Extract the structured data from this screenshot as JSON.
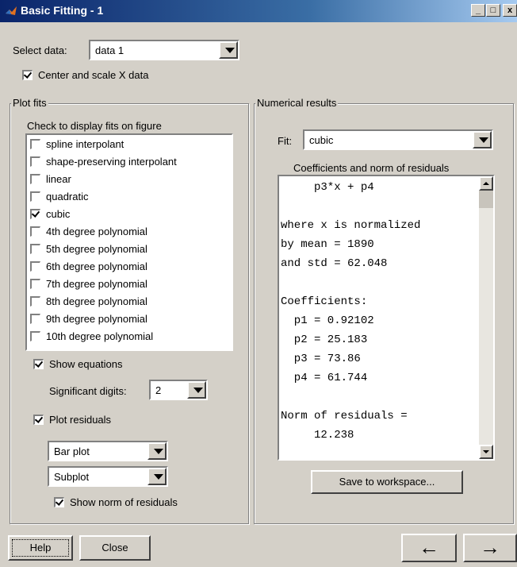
{
  "window": {
    "title": "Basic Fitting - 1",
    "minimize": "_",
    "maximize": "□",
    "close": "x"
  },
  "select_data": {
    "label": "Select data:",
    "value": "data 1"
  },
  "center_scale": {
    "label": "Center and scale X data",
    "checked": true
  },
  "plot_fits": {
    "title": "Plot fits",
    "instruction": "Check to display fits on figure",
    "items": [
      {
        "label": "spline interpolant",
        "checked": false
      },
      {
        "label": "shape-preserving interpolant",
        "checked": false
      },
      {
        "label": "linear",
        "checked": false
      },
      {
        "label": "quadratic",
        "checked": false
      },
      {
        "label": "cubic",
        "checked": true
      },
      {
        "label": "4th degree polynomial",
        "checked": false
      },
      {
        "label": "5th degree polynomial",
        "checked": false
      },
      {
        "label": "6th degree polynomial",
        "checked": false
      },
      {
        "label": "7th degree polynomial",
        "checked": false
      },
      {
        "label": "8th degree polynomial",
        "checked": false
      },
      {
        "label": "9th degree polynomial",
        "checked": false
      },
      {
        "label": "10th degree polynomial",
        "checked": false
      }
    ],
    "show_equations": {
      "label": "Show equations",
      "checked": true
    },
    "sig_digits": {
      "label": "Significant digits:",
      "value": "2"
    },
    "plot_residuals": {
      "label": "Plot residuals",
      "checked": true
    },
    "residual_plot_type": "Bar plot",
    "residual_location": "Subplot",
    "show_norm": {
      "label": "Show norm of residuals",
      "checked": true
    }
  },
  "numerical": {
    "title": "Numerical results",
    "fit_label": "Fit:",
    "fit_value": "cubic",
    "coeff_title": "Coefficients and norm of residuals",
    "lines": [
      "     p3*x + p4",
      "",
      "where x is normalized",
      "by mean = 1890",
      "and std = 62.048",
      "",
      "Coefficients:",
      "  p1 = 0.92102",
      "  p2 = 25.183",
      "  p3 = 73.86",
      "  p4 = 61.744",
      "",
      "Norm of residuals =",
      "     12.238"
    ],
    "save_button": "Save to workspace..."
  },
  "footer": {
    "help": "Help",
    "close": "Close",
    "back": "←",
    "forward": "→"
  }
}
